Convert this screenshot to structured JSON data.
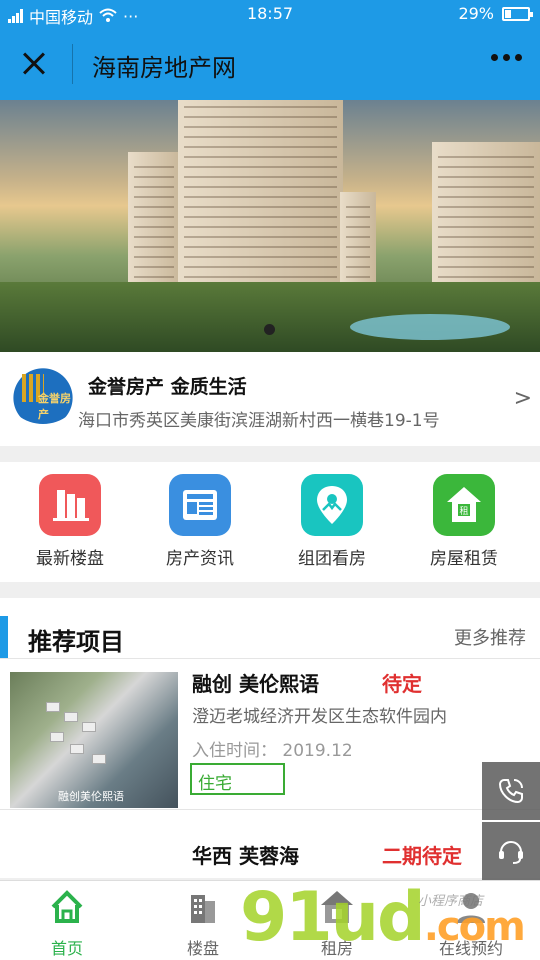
{
  "status_bar": {
    "carrier": "中国移动",
    "more": "···",
    "time": "18:57",
    "battery": "29%",
    "battery_level": 0.29
  },
  "header": {
    "title": "海南房地产网"
  },
  "company": {
    "logo_text": "金誉房产",
    "name": "金誉房产 金质生活",
    "address": "海口市秀英区美康街滨涯湖新村西一横巷19-1号",
    "arrow": ">"
  },
  "menu": {
    "items": [
      {
        "label": "最新楼盘",
        "icon": "building-icon",
        "color": "#f0585a"
      },
      {
        "label": "房产资讯",
        "icon": "news-icon",
        "color": "#3a8fe0"
      },
      {
        "label": "组团看房",
        "icon": "location-pin-icon",
        "color": "#19c5c0"
      },
      {
        "label": "房屋租赁",
        "icon": "rent-house-icon",
        "color": "#3bb73b"
      }
    ]
  },
  "recommend": {
    "title": "推荐项目",
    "more": "更多推荐",
    "projects": [
      {
        "name": "融创 美伦熙语",
        "status": "待定",
        "location": "澄迈老城经济开发区生态软件园内",
        "move_in": "入住时间：  2019.12",
        "tag": "住宅",
        "thumb_caption": "融创美伦熙语"
      },
      {
        "name": "华西 芙蓉海",
        "status": "二期待定"
      }
    ]
  },
  "floating": [
    "phone-icon",
    "customer-service-icon"
  ],
  "nav": {
    "items": [
      {
        "label": "首页",
        "icon": "home-icon",
        "active": true
      },
      {
        "label": "楼盘",
        "icon": "buildings-icon",
        "active": false
      },
      {
        "label": "租房",
        "icon": "rent-icon",
        "active": false
      },
      {
        "label": "在线预约",
        "icon": "appointment-icon",
        "active": false
      }
    ]
  },
  "watermark": {
    "main": "91ud",
    "suffix": ".com",
    "handwritten": "小程序商店"
  },
  "colors": {
    "primary": "#1e9ae6",
    "accent_red": "#e03030",
    "accent_green": "#2bb24c"
  }
}
